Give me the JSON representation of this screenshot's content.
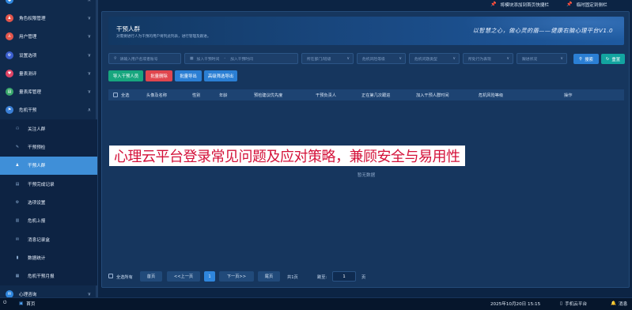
{
  "sidebar": {
    "items": [
      {
        "label": "",
        "icon": "top-icon",
        "color": "#2f86dd",
        "chev": "∧"
      },
      {
        "label": "角色权限管理",
        "icon": "role-icon",
        "color": "#e2554b",
        "chev": "∨"
      },
      {
        "label": "用户管理",
        "icon": "user-icon",
        "color": "#e2554b",
        "chev": "∨"
      },
      {
        "label": "设置选项",
        "icon": "settings-icon",
        "color": "#3a5fcf",
        "chev": "∨"
      },
      {
        "label": "量表测评",
        "icon": "assessment-icon",
        "color": "#e04466",
        "chev": "∨"
      },
      {
        "label": "量表库管理",
        "icon": "scale-library-icon",
        "color": "#3aa86c",
        "chev": "∨"
      },
      {
        "label": "危机干预",
        "icon": "crisis-icon",
        "color": "#3a7fd6",
        "chev": "∧"
      }
    ],
    "sub_items": [
      {
        "label": "关注人群",
        "icon": "follow-group-icon"
      },
      {
        "label": "干预预检",
        "icon": "pre-check-icon"
      },
      {
        "label": "干预人群",
        "icon": "intervention-group-icon",
        "active": true
      },
      {
        "label": "干预完成记录",
        "icon": "completion-record-icon"
      },
      {
        "label": "选项设置",
        "icon": "option-settings-icon"
      },
      {
        "label": "危机上报",
        "icon": "crisis-report-icon"
      },
      {
        "label": "消息记录盒",
        "icon": "message-box-icon"
      },
      {
        "label": "数据统计",
        "icon": "statistics-icon"
      },
      {
        "label": "危机干预月报",
        "icon": "monthly-report-icon"
      }
    ],
    "bottom_items": [
      {
        "label": "心理咨询",
        "icon": "counseling-icon",
        "color": "#2f86dd",
        "chev": "∨"
      },
      {
        "label": "用户档案",
        "icon": "archive-icon",
        "color": "#e2554b",
        "chev": "∨"
      }
    ]
  },
  "topbar": {
    "add_shortcut": "将模块添加到首页快捷栏",
    "pin_sidebar": "临时固定到侧栏"
  },
  "hero": {
    "title": "干预人群",
    "subtitle": "对需要进行人为干预的用户将列此列表，进行管理及跟进。",
    "slogan": "以智慧之心，做心灵的盾——健康右脑心理平台V1.0"
  },
  "filters": {
    "search_placeholder": "请输入用户名或者账号",
    "start_time": "加入干预时间",
    "to": "-",
    "end_time": "加入干预时间",
    "department": "所在部门/班级",
    "risk_level": "危机风险等级",
    "issue_type": "危机问题类型",
    "stage": "所处行为表现",
    "status": "跟进状况",
    "search_btn": "搜索",
    "reset_btn": "重置"
  },
  "actions": {
    "import": "导入干预人员",
    "batch_delete": "批量删除",
    "batch_export": "批量导出",
    "advanced_export": "高级筛选导出"
  },
  "table": {
    "columns": [
      "全选",
      "头像及名称",
      "性别",
      "年龄",
      "预检建议优先度",
      "干预负责人",
      "正在第几次跟进",
      "加入干预人群时间",
      "危机风险等级",
      "操作"
    ],
    "empty_text": "暂无数据"
  },
  "pager": {
    "select_all": "全选所有",
    "first": "首页",
    "prev": "<<上一页",
    "current": "1",
    "next": "下一页>>",
    "last": "尾页",
    "total": "共1页",
    "jump": "跳至:",
    "jump_value": "1",
    "page_unit": "页"
  },
  "banner": {
    "text": "心理云平台登录常见问题及应对策略，兼顾安全与易用性"
  },
  "taskbar": {
    "home": "首页",
    "datetime": "2025年10月20日 15:15",
    "mobile": "手机云平台",
    "messages": "消息"
  }
}
